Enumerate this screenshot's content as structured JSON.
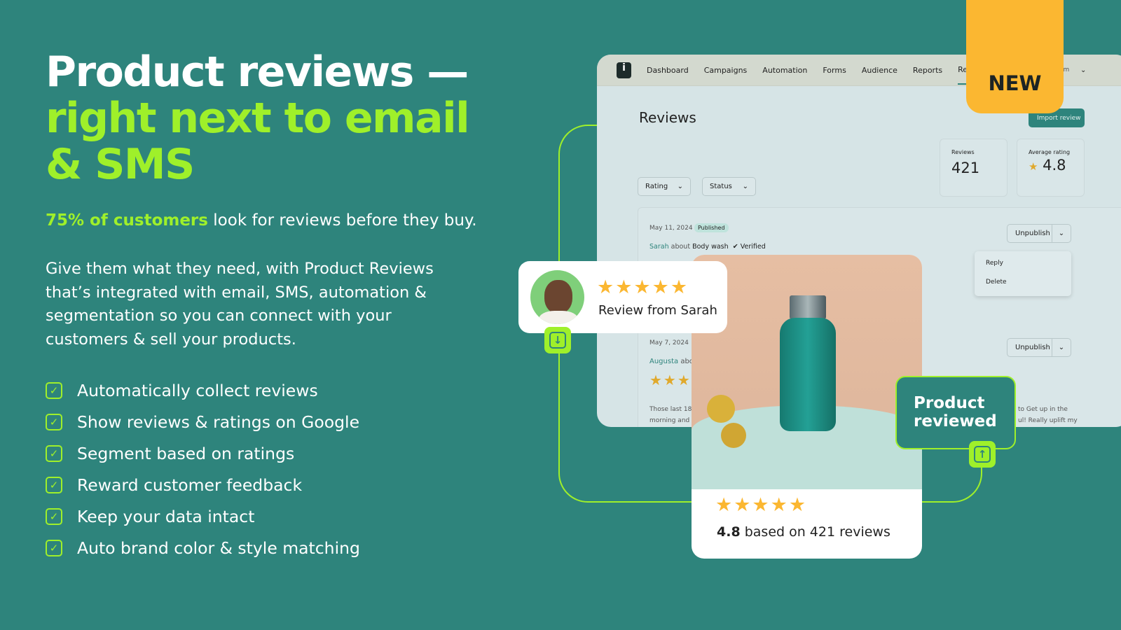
{
  "hero": {
    "line1": "Product reviews —",
    "line2": "right next to email",
    "line3": "& SMS",
    "sub_highlight": "75% of customers",
    "sub_rest": " look for reviews before they buy.",
    "paragraph": "Give them what they need, with Product Reviews that’s integrated with email, SMS, automation & segmentation so you can connect with your customers & sell your products.",
    "features": [
      "Automatically collect reviews",
      "Show reviews & ratings on Google",
      "Segment based on ratings",
      "Reward customer feedback",
      "Keep your data intact",
      "Auto brand color & style matching"
    ]
  },
  "app": {
    "nav": [
      "Dashboard",
      "Campaigns",
      "Automation",
      "Forms",
      "Audience",
      "Reports",
      "Reviews"
    ],
    "nav_trailing": "om",
    "title": "Reviews",
    "import_button": "Import review",
    "filters": [
      "Rating",
      "Status"
    ],
    "stats": [
      {
        "label": "Reviews",
        "value": "421"
      },
      {
        "label": "Average rating",
        "value": "4.8"
      }
    ],
    "reviews": [
      {
        "date": "May 11, 2024",
        "status": "Published",
        "author": "Sarah",
        "about": "about",
        "product": "Body wash",
        "verified": "Verified",
        "action": "Unpublish",
        "menu": [
          "Reply",
          "Delete"
        ]
      },
      {
        "date": "May 7, 2024",
        "author": "Augusta",
        "about": "abo",
        "action": "Unpublish",
        "text_left1": "Those last 18 r",
        "text_left2": "morning and e",
        "text_right1": "to  Get up in the",
        "text_right2": "ul! Really uplift my"
      }
    ]
  },
  "badge_new": "NEW",
  "review_card": {
    "stars": "★★★★★",
    "label": "Review from Sarah"
  },
  "product_card": {
    "stars": "★★★★★",
    "rating": "4.8",
    "rating_rest": " based on 421 reviews"
  },
  "product_reviewed": "Product reviewed",
  "colors": {
    "background": "#2e847c",
    "accent": "#9ff02a",
    "new_badge": "#fbb731",
    "star": "#fbb731"
  }
}
